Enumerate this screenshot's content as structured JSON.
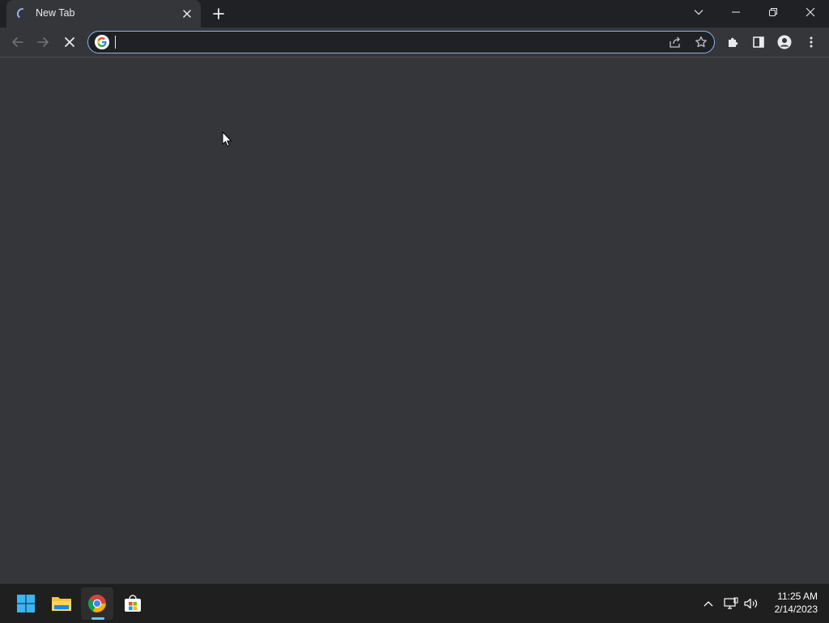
{
  "tab": {
    "title": "New Tab",
    "loading": true
  },
  "omnibox": {
    "value": "",
    "placeholder": ""
  },
  "icons": {
    "tab_spinner": "loading-spinner-icon",
    "tab_close": "close-icon",
    "new_tab": "plus-icon",
    "tab_search": "chevron-down-icon",
    "minimize": "minimize-icon",
    "restore": "restore-icon",
    "close_window": "close-icon",
    "back": "arrow-left-icon",
    "forward": "arrow-right-icon",
    "stop": "stop-icon",
    "search_engine": "google-g-icon",
    "share": "share-icon",
    "bookmark": "star-icon",
    "extensions": "puzzle-icon",
    "side_panel": "side-panel-icon",
    "profile": "person-icon",
    "menu": "kebab-menu-icon"
  },
  "taskbar": {
    "apps": [
      {
        "name": "Start",
        "icon": "windows-logo-icon",
        "active": false
      },
      {
        "name": "File Explorer",
        "icon": "folder-icon",
        "active": false
      },
      {
        "name": "Google Chrome",
        "icon": "chrome-icon",
        "active": true
      },
      {
        "name": "Microsoft Store",
        "icon": "store-icon",
        "active": false
      }
    ],
    "tray": {
      "time": "11:25 AM",
      "date": "2/14/2023"
    }
  },
  "colors": {
    "titlebar": "#202124",
    "toolbar": "#35363a",
    "omnibox_focus": "#8ab4f8",
    "taskbar": "#1f1f1f",
    "active_indicator": "#60cdff"
  }
}
